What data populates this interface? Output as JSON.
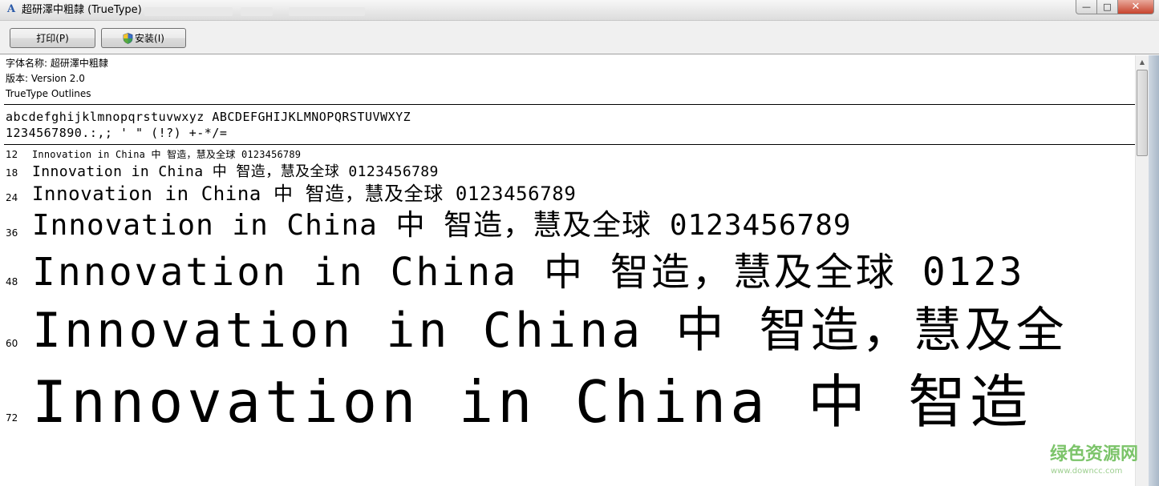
{
  "window": {
    "title": "超研澤中粗隸 (TrueType)",
    "app_icon": "font-viewer-icon",
    "controls": {
      "minimize": "—",
      "maximize": "□",
      "close": "✕"
    }
  },
  "toolbar": {
    "print_label": "打印(P)",
    "install_label": "安装(I)"
  },
  "info": {
    "font_name": "字体名称: 超研澤中粗隸",
    "version": "版本: Version 2.0",
    "outlines": "TrueType Outlines"
  },
  "charset": {
    "letters": "abcdefghijklmnopqrstuvwxyz ABCDEFGHIJKLMNOPQRSTUVWXYZ",
    "digits_symbols": "1234567890.:,; ' \" (!?) +-*/="
  },
  "samples": [
    {
      "size": "12",
      "text": "Innovation in China 中  智造，慧及全球 0123456789"
    },
    {
      "size": "18",
      "text": "Innovation in China 中  智造，慧及全球 0123456789"
    },
    {
      "size": "24",
      "text": "Innovation in China 中  智造，慧及全球 0123456789"
    },
    {
      "size": "36",
      "text": "Innovation in China 中  智造，慧及全球 0123456789"
    },
    {
      "size": "48",
      "text": "Innovation in China 中  智造，慧及全球 0123"
    },
    {
      "size": "60",
      "text": "Innovation in China 中  智造，慧及全"
    },
    {
      "size": "72",
      "text": "Innovation in China 中  智造"
    }
  ],
  "watermark": {
    "main": "绿色资源网",
    "url": "www.downcc.com"
  },
  "colors": {
    "watermark": "#7cc46a",
    "close_button": "#c7432d"
  }
}
